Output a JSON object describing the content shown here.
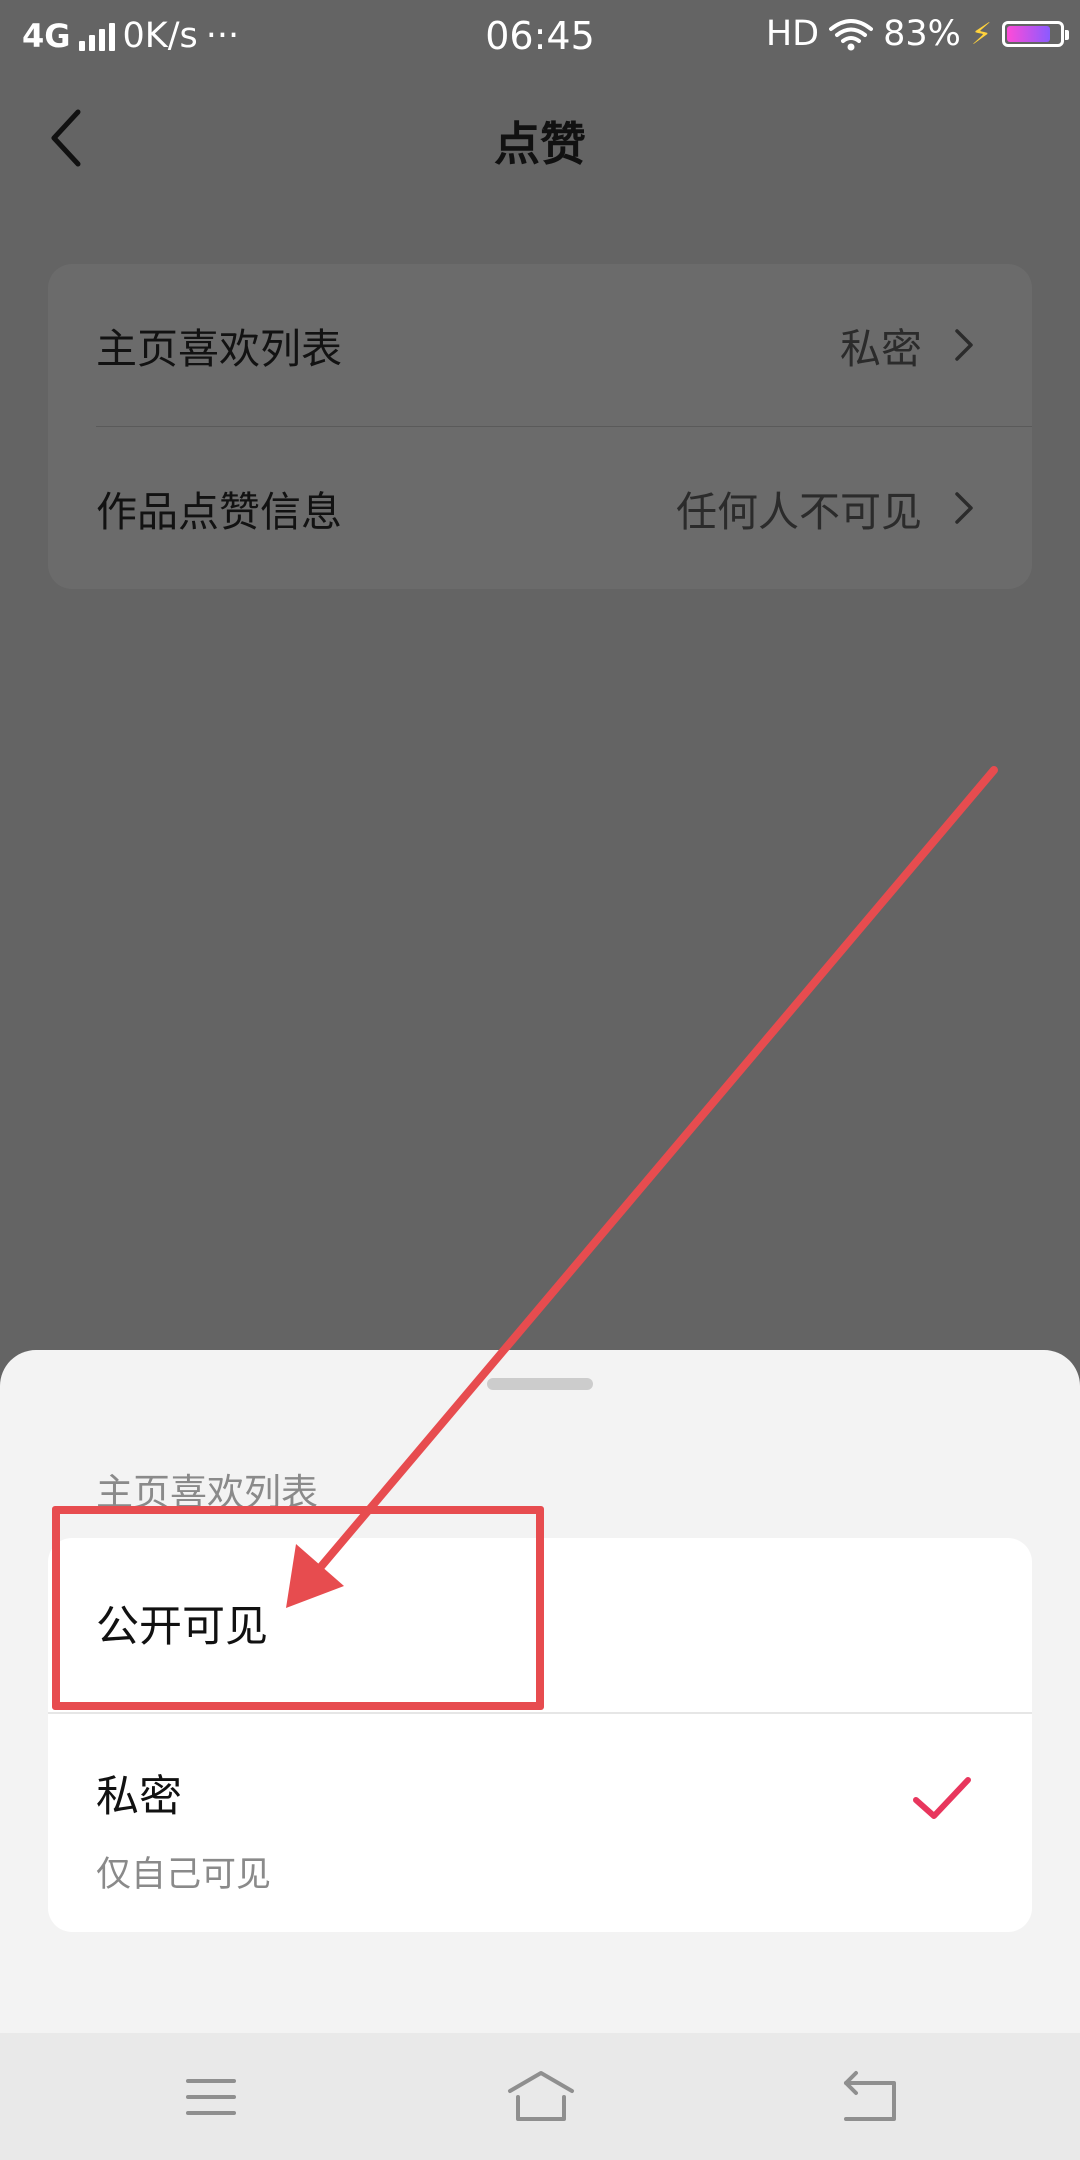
{
  "status_bar": {
    "network": "4G",
    "speed": "0K/s",
    "more": "···",
    "time": "06:45",
    "hd": "HD",
    "battery_percent": "83%",
    "battery_level": 0.83,
    "icons": [
      "signal-icon",
      "wifi-icon",
      "charging-icon",
      "battery-icon"
    ]
  },
  "header": {
    "title": "点赞",
    "back_icon": "chevron-left-icon"
  },
  "settings": {
    "rows": [
      {
        "label": "主页喜欢列表",
        "value": "私密"
      },
      {
        "label": "作品点赞信息",
        "value": "任何人不可见"
      }
    ]
  },
  "sheet": {
    "title": "主页喜欢列表",
    "options": [
      {
        "label": "公开可见",
        "selected": false
      },
      {
        "label": "私密",
        "description": "仅自己可见",
        "selected": true
      }
    ],
    "check_color": "#e8365d"
  },
  "annotation": {
    "color": "#e74c4f",
    "shapes": [
      "highlight-box",
      "arrow"
    ]
  },
  "nav_bar": {
    "icons": [
      "menu-icon",
      "home-icon",
      "back-icon"
    ]
  },
  "colors": {
    "dim_overlay": "#646464",
    "sheet_bg": "#f3f3f3",
    "card_bg": "#ffffff"
  }
}
